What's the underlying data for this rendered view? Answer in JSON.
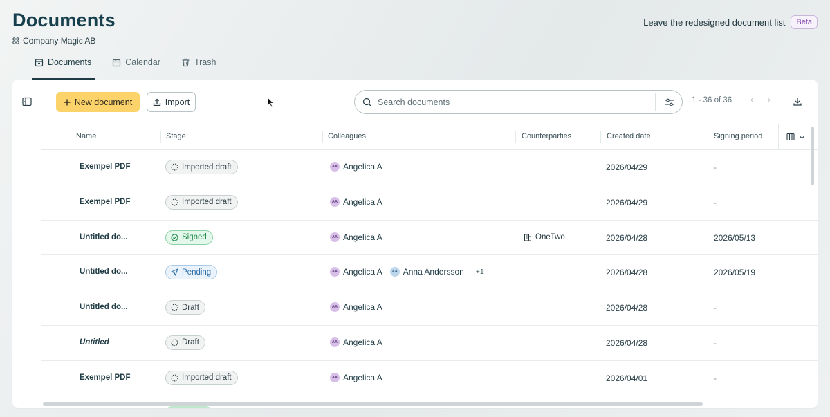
{
  "header": {
    "title": "Documents",
    "company": "Company Magic AB",
    "leave_link": "Leave the redesigned document list",
    "beta": "Beta"
  },
  "tabs": [
    {
      "label": "Documents",
      "icon": "folder-icon",
      "active": true
    },
    {
      "label": "Calendar",
      "icon": "calendar-icon",
      "active": false
    },
    {
      "label": "Trash",
      "icon": "trash-icon",
      "active": false
    }
  ],
  "toolbar": {
    "new_label": "New document",
    "import_label": "Import",
    "search_placeholder": "Search documents",
    "pager_text": "1 - 36 of 36"
  },
  "columns": [
    "Name",
    "Stage",
    "Colleagues",
    "Counterparties",
    "Created date",
    "Signing period"
  ],
  "rows": [
    {
      "name": "Exempel PDF",
      "italic": false,
      "stage": "Imported draft",
      "stage_type": "neutral",
      "colleagues": [
        {
          "initials": "AA",
          "name": "Angelica A",
          "color": "purple"
        }
      ],
      "more": "",
      "counterparty": "",
      "created": "2026/04/29",
      "signing": "-"
    },
    {
      "name": "Exempel PDF",
      "italic": false,
      "stage": "Imported draft",
      "stage_type": "neutral",
      "colleagues": [
        {
          "initials": "AA",
          "name": "Angelica A",
          "color": "purple"
        }
      ],
      "more": "",
      "counterparty": "",
      "created": "2026/04/29",
      "signing": "-"
    },
    {
      "name": "Untitled do...",
      "italic": false,
      "stage": "Signed",
      "stage_type": "signed",
      "colleagues": [
        {
          "initials": "AA",
          "name": "Angelica A",
          "color": "purple"
        }
      ],
      "more": "",
      "counterparty": "OneTwo",
      "created": "2026/04/28",
      "signing": "2026/05/13"
    },
    {
      "name": "Untitled do...",
      "italic": false,
      "stage": "Pending",
      "stage_type": "pending",
      "colleagues": [
        {
          "initials": "AA",
          "name": "Angelica A",
          "color": "purple"
        },
        {
          "initials": "AA",
          "name": "Anna Andersson",
          "color": "blue"
        }
      ],
      "more": "+1",
      "counterparty": "",
      "created": "2026/04/28",
      "signing": "2026/05/19"
    },
    {
      "name": "Untitled do...",
      "italic": false,
      "stage": "Draft",
      "stage_type": "neutral",
      "colleagues": [
        {
          "initials": "AA",
          "name": "Angelica A",
          "color": "purple"
        }
      ],
      "more": "",
      "counterparty": "",
      "created": "2026/04/28",
      "signing": "-"
    },
    {
      "name": "Untitled",
      "italic": true,
      "stage": "Draft",
      "stage_type": "neutral",
      "colleagues": [
        {
          "initials": "AA",
          "name": "Angelica A",
          "color": "purple"
        }
      ],
      "more": "",
      "counterparty": "",
      "created": "2026/04/28",
      "signing": "-"
    },
    {
      "name": "Exempel PDF",
      "italic": false,
      "stage": "Imported draft",
      "stage_type": "neutral",
      "colleagues": [
        {
          "initials": "AA",
          "name": "Angelica A",
          "color": "purple"
        }
      ],
      "more": "",
      "counterparty": "",
      "created": "2026/04/01",
      "signing": "-"
    }
  ],
  "colors": {
    "accent_yellow": "#fcd26b",
    "title": "#173f4d",
    "signed_green": "#1f8a4b",
    "pending_blue": "#2b6ea8",
    "beta_purple": "#7b3fa8"
  }
}
